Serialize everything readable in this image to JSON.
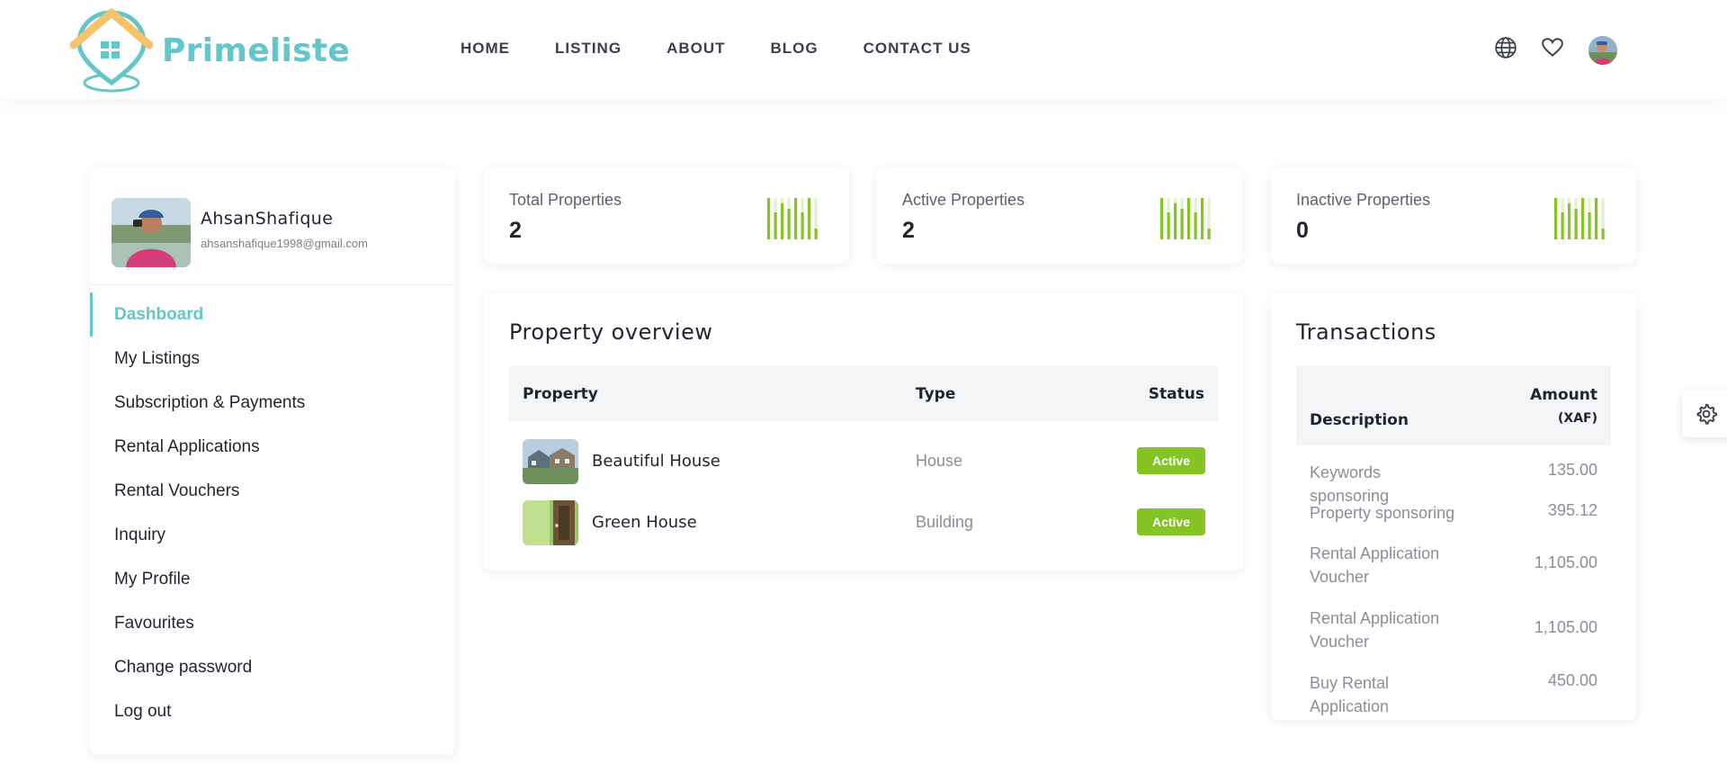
{
  "brand": {
    "name": "Primeliste",
    "color": "#63c6c8"
  },
  "nav": {
    "items": [
      "HOME",
      "LISTING",
      "ABOUT",
      "BLOG",
      "CONTACT US"
    ]
  },
  "header_icons": [
    "globe-icon",
    "heart-icon",
    "user-avatar"
  ],
  "profile": {
    "name": "AhsanShafique",
    "email": "ahsanshafique1998@gmail.com"
  },
  "sidebar": {
    "items": [
      {
        "label": "Dashboard",
        "active": true
      },
      {
        "label": "My Listings"
      },
      {
        "label": "Subscription & Payments"
      },
      {
        "label": "Rental Applications"
      },
      {
        "label": "Rental Vouchers"
      },
      {
        "label": "Inquiry"
      },
      {
        "label": "My Profile"
      },
      {
        "label": "Favourites"
      },
      {
        "label": "Change password"
      },
      {
        "label": "Log out"
      }
    ]
  },
  "stats": [
    {
      "label": "Total Properties",
      "value": "2"
    },
    {
      "label": "Active Properties",
      "value": "2"
    },
    {
      "label": "Inactive Properties",
      "value": "0"
    }
  ],
  "overview": {
    "title": "Property overview",
    "columns": {
      "property": "Property",
      "type": "Type",
      "status": "Status"
    },
    "rows": [
      {
        "name": "Beautiful House",
        "type": "House",
        "status": "Active"
      },
      {
        "name": "Green House",
        "type": "Building",
        "status": "Active"
      }
    ]
  },
  "transactions": {
    "title": "Transactions",
    "columns": {
      "description": "Description",
      "amount": "Amount",
      "currency": "(XAF)"
    },
    "rows": [
      {
        "description": "Keywords sponsoring",
        "amount": "135.00"
      },
      {
        "description": "Property sponsoring",
        "amount": "395.12"
      },
      {
        "description": "Rental Application Voucher",
        "amount": "1,105.00"
      },
      {
        "description": "Rental Application Voucher",
        "amount": "1,105.00"
      },
      {
        "description": "Buy Rental Application",
        "amount": "450.00"
      }
    ]
  },
  "colors": {
    "accent": "#63c6c8",
    "active_badge": "#84c425",
    "text_dark": "#1f2430",
    "text_muted": "#8a8f97"
  }
}
